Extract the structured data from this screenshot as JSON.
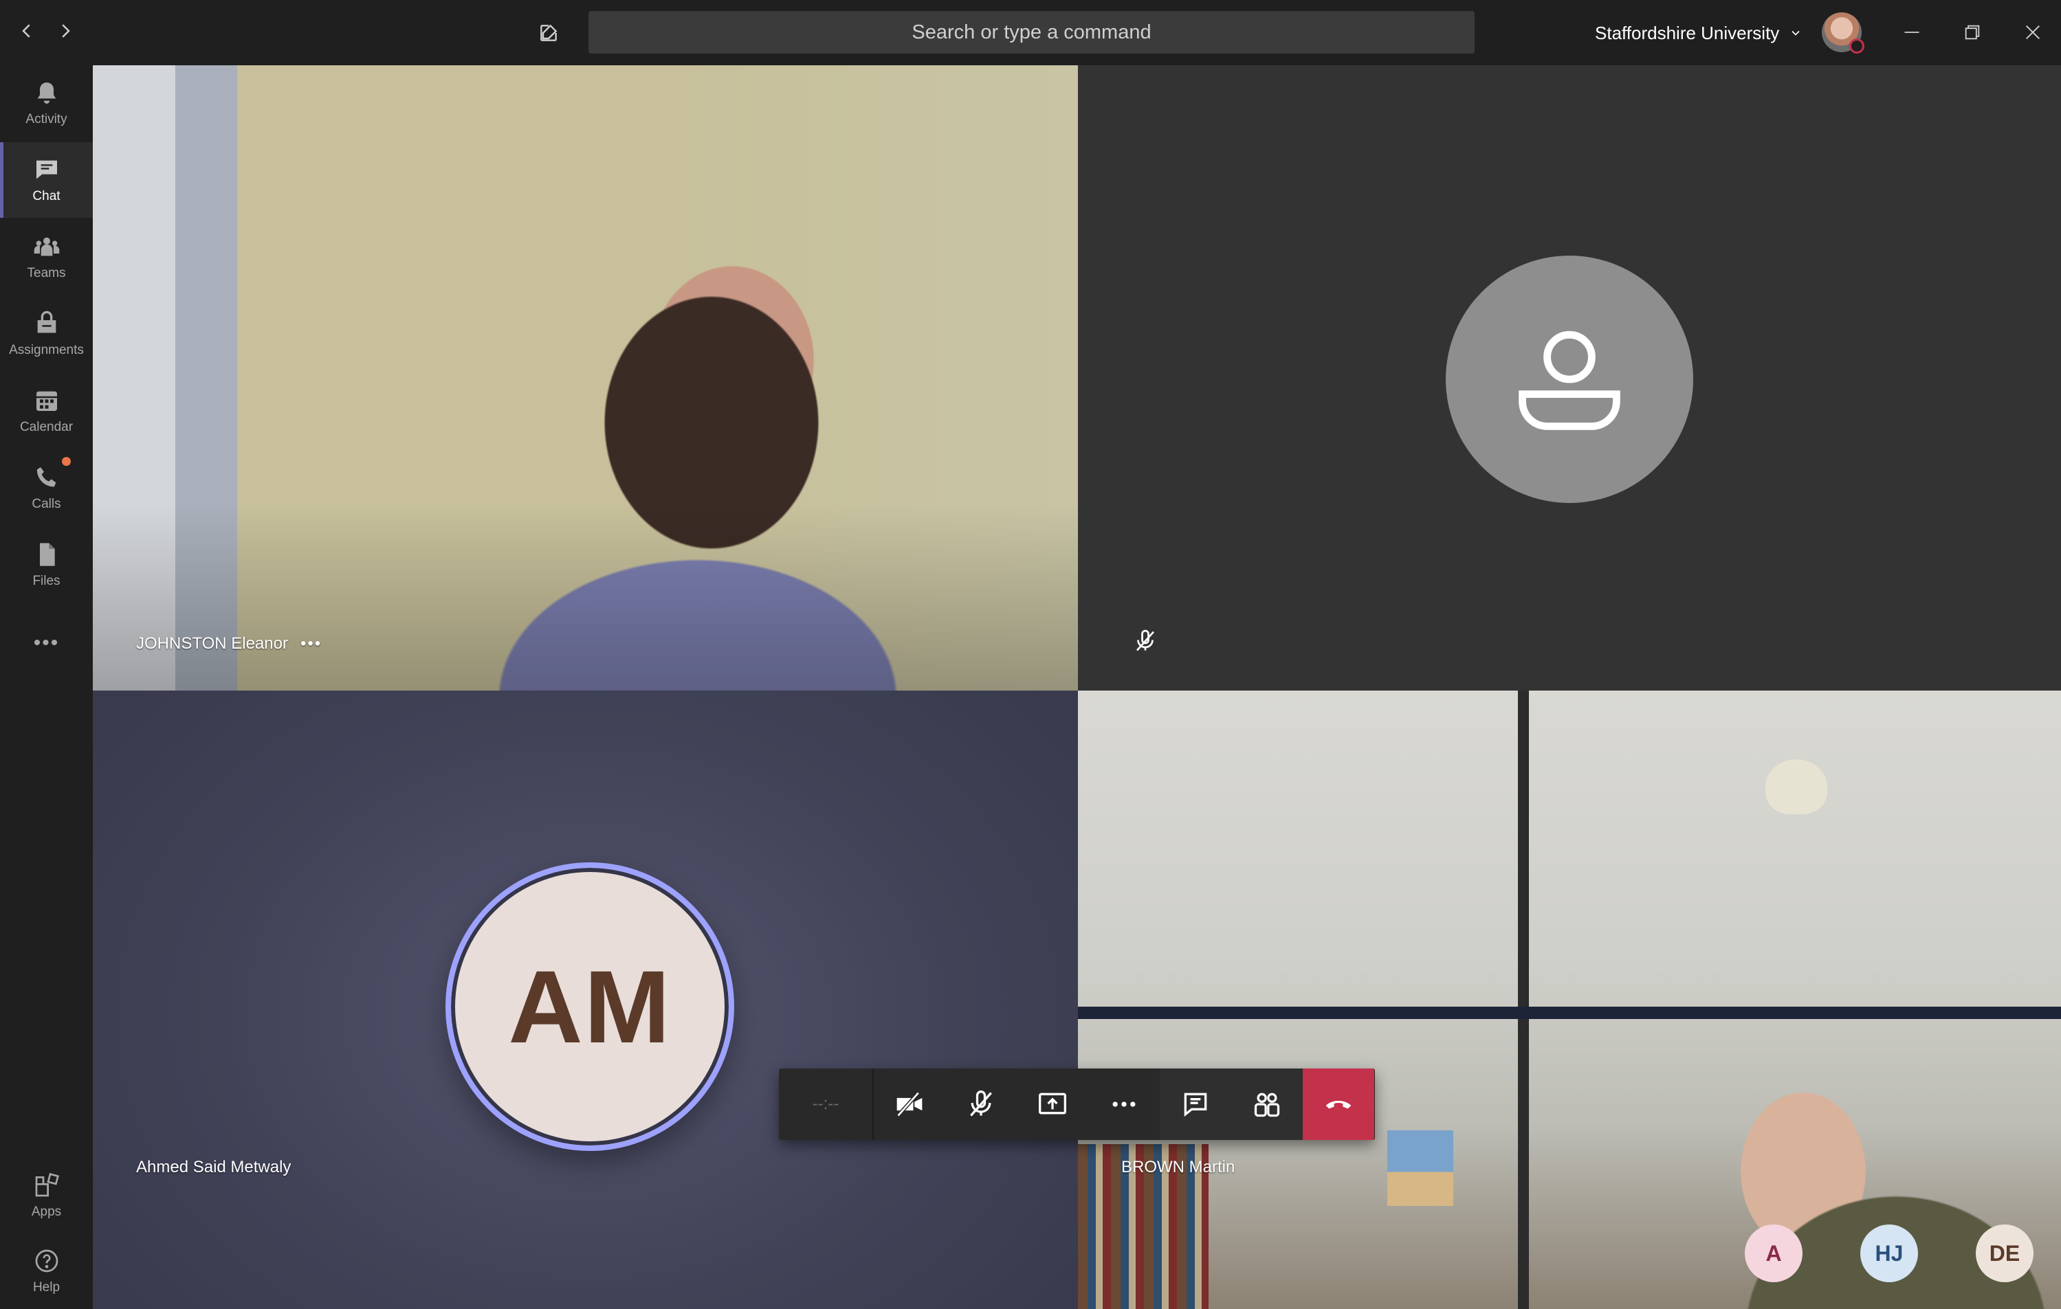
{
  "titlebar": {
    "search_placeholder": "Search or type a command",
    "organization": "Staffordshire University"
  },
  "rail": {
    "items": [
      {
        "label": "Activity",
        "icon": "bell-icon"
      },
      {
        "label": "Chat",
        "icon": "chat-icon",
        "active": true
      },
      {
        "label": "Teams",
        "icon": "teams-icon"
      },
      {
        "label": "Assignments",
        "icon": "assignments-icon"
      },
      {
        "label": "Calendar",
        "icon": "calendar-icon"
      },
      {
        "label": "Calls",
        "icon": "phone-icon",
        "notification": true
      },
      {
        "label": "Files",
        "icon": "file-icon"
      }
    ],
    "more": "•••",
    "bottom": [
      {
        "label": "Apps",
        "icon": "apps-icon"
      },
      {
        "label": "Help",
        "icon": "help-icon"
      }
    ]
  },
  "participants": [
    {
      "name": "JOHNSTON Eleanor",
      "more": "•••",
      "video": true
    },
    {
      "name": "",
      "muted": true,
      "video": false
    },
    {
      "name": "Ahmed Said Metwaly",
      "initials": "AM",
      "video": false
    },
    {
      "name": "BROWN Martin",
      "video": true
    }
  ],
  "call_controls": {
    "timer": "--:--",
    "buttons": [
      "camera-off-icon",
      "mic-off-icon",
      "share-screen-icon",
      "more-icon",
      "chat-icon",
      "participants-icon",
      "hang-up-icon"
    ]
  },
  "roster": [
    {
      "initials": "A",
      "bg": "#f5d6df",
      "fg": "#8a2a47"
    },
    {
      "initials": "HJ",
      "bg": "#d5e5f3",
      "fg": "#2a4f7c"
    },
    {
      "initials": "DE",
      "bg": "#eee3db",
      "fg": "#5b3a29"
    }
  ],
  "colors": {
    "accent": "#6264a7",
    "hangup": "#c4314b",
    "notification": "#e97548"
  }
}
